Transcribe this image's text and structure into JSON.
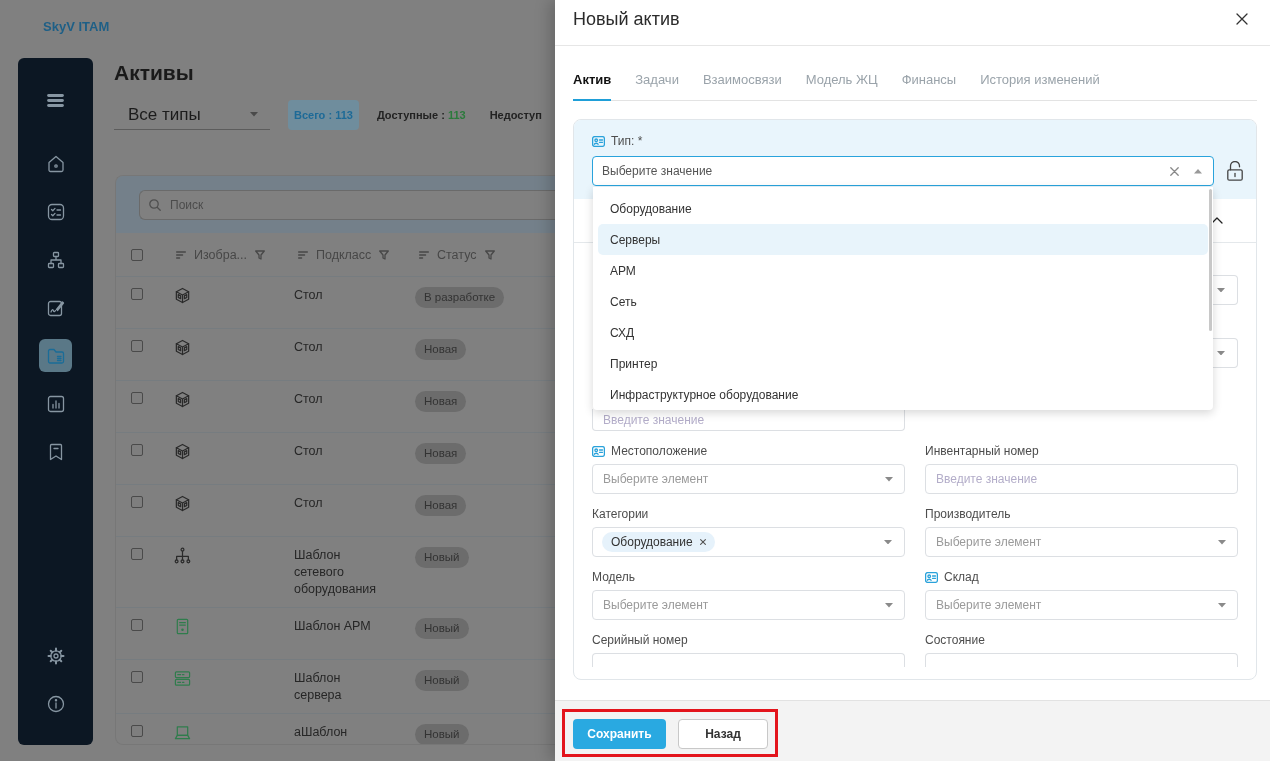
{
  "app": {
    "logo": "SkyV ITAM"
  },
  "sidebar": {
    "items": [
      {
        "selected": false
      },
      {
        "selected": false
      },
      {
        "selected": false
      },
      {
        "selected": false
      },
      {
        "selected": true
      },
      {
        "selected": false
      },
      {
        "selected": false
      }
    ]
  },
  "page": {
    "title": "Активы",
    "type_filter": {
      "value": "Все типы"
    },
    "counters": [
      {
        "kind": "total",
        "label": "Всего :",
        "count": "113",
        "selected": true
      },
      {
        "kind": "available",
        "label": "Доступные :",
        "count": "113",
        "selected": false
      },
      {
        "kind": "unavailable",
        "label": "Недоступ",
        "selected": false
      }
    ]
  },
  "table": {
    "search": {
      "placeholder": "Поиск"
    },
    "select_all": {
      "checked": false
    },
    "columns": [
      {
        "label": "Изобра..."
      },
      {
        "label": "Подкласс"
      },
      {
        "label": "Статус"
      }
    ],
    "rows": [
      {
        "kind": "furniture",
        "checked": false,
        "subclass": "Стол",
        "status": "В разработке"
      },
      {
        "kind": "furniture",
        "checked": false,
        "subclass": "Стол",
        "status": "Новая"
      },
      {
        "kind": "furniture",
        "checked": false,
        "subclass": "Стол",
        "status": "Новая"
      },
      {
        "kind": "furniture",
        "checked": false,
        "subclass": "Стол",
        "status": "Новая"
      },
      {
        "kind": "furniture",
        "checked": false,
        "subclass": "Стол",
        "status": "Новая"
      },
      {
        "kind": "network",
        "checked": false,
        "subclass": "Шаблон сетевого оборудования",
        "status": "Новый"
      },
      {
        "kind": "workstation",
        "checked": false,
        "subclass": "Шаблон АРМ",
        "status": "Новый"
      },
      {
        "kind": "server",
        "checked": false,
        "subclass": "Шаблон сервера",
        "status": "Новый"
      },
      {
        "kind": "laptop",
        "checked": false,
        "subclass": "аШаблон",
        "status": "Новый"
      }
    ]
  },
  "modal": {
    "title": "Новый актив",
    "tabs": [
      {
        "label": "Актив",
        "selected": true
      },
      {
        "label": "Задачи",
        "selected": false
      },
      {
        "label": "Взаимосвязи",
        "selected": false
      },
      {
        "label": "Модель ЖЦ",
        "selected": false
      },
      {
        "label": "Финансы",
        "selected": false
      },
      {
        "label": "История изменений",
        "selected": false
      }
    ],
    "type_field": {
      "label": "Тип: *",
      "marked": true,
      "focused": true,
      "placeholder": "Выберите значение",
      "expanded": true,
      "options": [
        {
          "label": "Оборудование",
          "selected": false
        },
        {
          "label": "Серверы",
          "selected": true
        },
        {
          "label": "АРМ",
          "selected": false
        },
        {
          "label": "Сеть",
          "selected": false
        },
        {
          "label": "СХД",
          "selected": false
        },
        {
          "label": "Принтер",
          "selected": false
        },
        {
          "label": "Инфраструктурное оборудование",
          "selected": false
        }
      ]
    },
    "section": {
      "expanded": true
    },
    "covered_fields": [
      {
        "kind": "select"
      },
      {
        "kind": "select"
      },
      {
        "kind": "input",
        "placeholder": "Введите значение"
      }
    ],
    "fields": [
      {
        "label": "Местоположение",
        "marked": true,
        "kind": "select",
        "placeholder": "Выберите элемент"
      },
      {
        "label": "Инвентарный номер",
        "marked": false,
        "kind": "input",
        "placeholder": "Введите значение"
      },
      {
        "label": "Категории",
        "marked": false,
        "kind": "tags",
        "tags": [
          {
            "label": "Оборудование"
          }
        ]
      },
      {
        "label": "Производитель",
        "marked": false,
        "kind": "select",
        "placeholder": "Выберите элемент"
      },
      {
        "label": "Модель",
        "marked": false,
        "kind": "select",
        "placeholder": "Выберите элемент"
      },
      {
        "label": "Склад",
        "marked": true,
        "kind": "select",
        "placeholder": "Выберите элемент"
      },
      {
        "label": "Серийный номер",
        "marked": false,
        "kind": "input",
        "clipped": true
      },
      {
        "label": "Состояние",
        "marked": false,
        "kind": "select",
        "clipped": true
      }
    ],
    "footer": {
      "annotation_frame": true,
      "buttons": [
        {
          "label": "Сохранить",
          "kind": "primary"
        },
        {
          "label": "Назад",
          "kind": "secondary"
        }
      ]
    }
  }
}
